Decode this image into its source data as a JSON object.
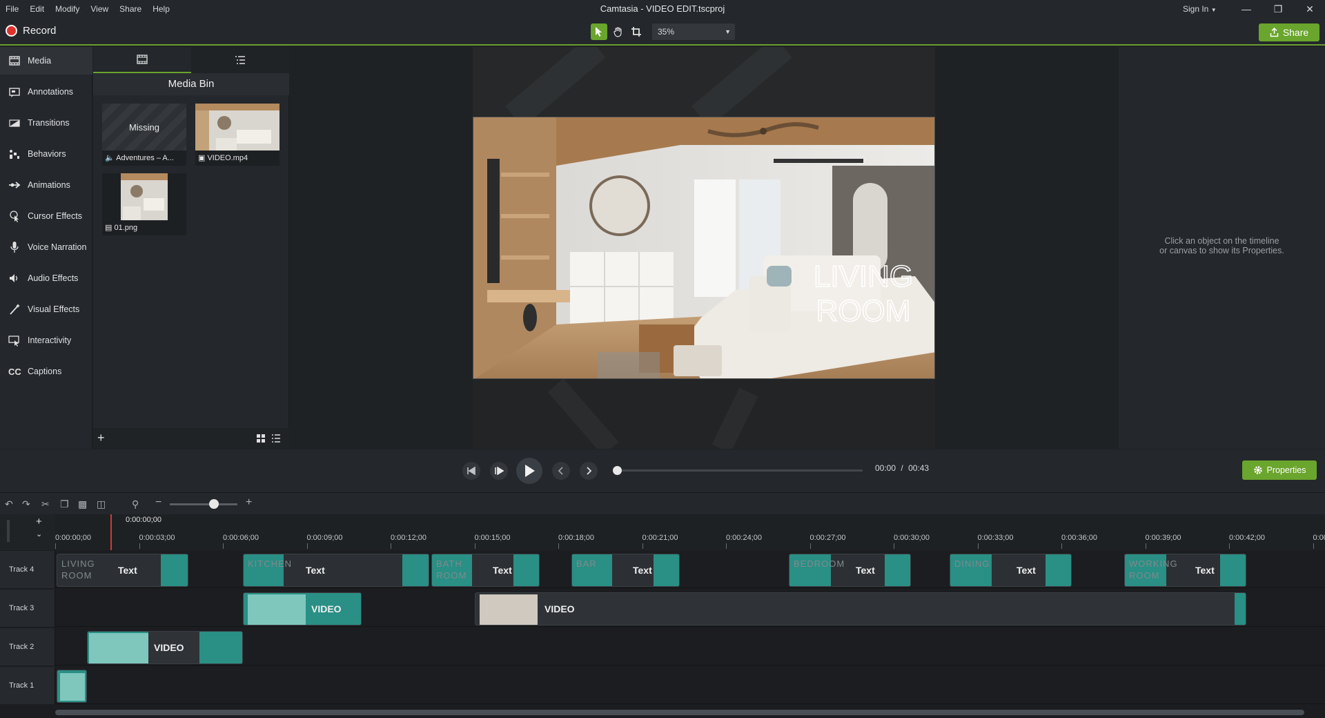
{
  "menubar": {
    "items": [
      "File",
      "Edit",
      "Modify",
      "View",
      "Share",
      "Help"
    ],
    "title": "Camtasia - VIDEO EDIT.tscproj",
    "signin": "Sign In"
  },
  "toolbar": {
    "record_label": "Record",
    "zoom_value": "35%",
    "share_label": "Share"
  },
  "sidebar": {
    "items": [
      {
        "label": "Media",
        "icon": "film-icon"
      },
      {
        "label": "Annotations",
        "icon": "annotation-icon"
      },
      {
        "label": "Transitions",
        "icon": "transition-icon"
      },
      {
        "label": "Behaviors",
        "icon": "behavior-icon"
      },
      {
        "label": "Animations",
        "icon": "animation-icon"
      },
      {
        "label": "Cursor Effects",
        "icon": "cursor-icon"
      },
      {
        "label": "Voice Narration",
        "icon": "microphone-icon"
      },
      {
        "label": "Audio Effects",
        "icon": "speaker-icon"
      },
      {
        "label": "Visual Effects",
        "icon": "wand-icon"
      },
      {
        "label": "Interactivity",
        "icon": "interactivity-icon"
      },
      {
        "label": "Captions",
        "icon": "cc-icon"
      }
    ]
  },
  "media": {
    "title": "Media Bin",
    "items": [
      {
        "name": "Adventures – A...",
        "missing_label": "Missing",
        "icon": "audio-icon"
      },
      {
        "name": "VIDEO.mp4",
        "icon": "video-icon"
      },
      {
        "name": "01.png",
        "icon": "image-icon"
      }
    ]
  },
  "canvas": {
    "overlay_line1": "LIVING",
    "overlay_line2": "ROOM"
  },
  "properties": {
    "message_line1": "Click an object on the timeline",
    "message_line2": "or canvas to show its Properties.",
    "button_label": "Properties"
  },
  "player": {
    "current_time": "00:00",
    "separator": "/",
    "total_time": "00:43"
  },
  "timeline": {
    "playhead_time": "0:00:00;00",
    "ticks": [
      "0:00:00;00",
      "0:00:03;00",
      "0:00:06;00",
      "0:00:09;00",
      "0:00:12;00",
      "0:00:15;00",
      "0:00:18;00",
      "0:00:21;00",
      "0:00:24;00",
      "0:00:27;00",
      "0:00:30;00",
      "0:00:33;00",
      "0:00:36;00",
      "0:00:39;00",
      "0:00:42;00",
      "0:00"
    ],
    "tracks": [
      {
        "name": "Track 4"
      },
      {
        "name": "Track 3"
      },
      {
        "name": "Track 2"
      },
      {
        "name": "Track 1"
      }
    ],
    "track4_clips": [
      {
        "label": "Text",
        "ghost1": "LIVING",
        "ghost2": "ROOM"
      },
      {
        "label": "Text",
        "ghost1": "KITCHEN",
        "ghost2": ""
      },
      {
        "label": "Text",
        "ghost1": "BATH",
        "ghost2": "ROOM"
      },
      {
        "label": "Text",
        "ghost1": "BAR",
        "ghost2": ""
      },
      {
        "label": "Text",
        "ghost1": "BEDROOM",
        "ghost2": ""
      },
      {
        "label": "Text",
        "ghost1": "DINING",
        "ghost2": ""
      },
      {
        "label": "Text",
        "ghost1": "WORKING",
        "ghost2": "ROOM"
      }
    ],
    "track3_clips": [
      {
        "label": "VIDEO"
      },
      {
        "label": "VIDEO"
      }
    ],
    "track2_clips": [
      {
        "label": "VIDEO"
      }
    ]
  },
  "colors": {
    "accent": "#6aa52d",
    "record": "#e0322c",
    "clip_teal": "#2a8f85",
    "playhead": "#d03a34"
  }
}
